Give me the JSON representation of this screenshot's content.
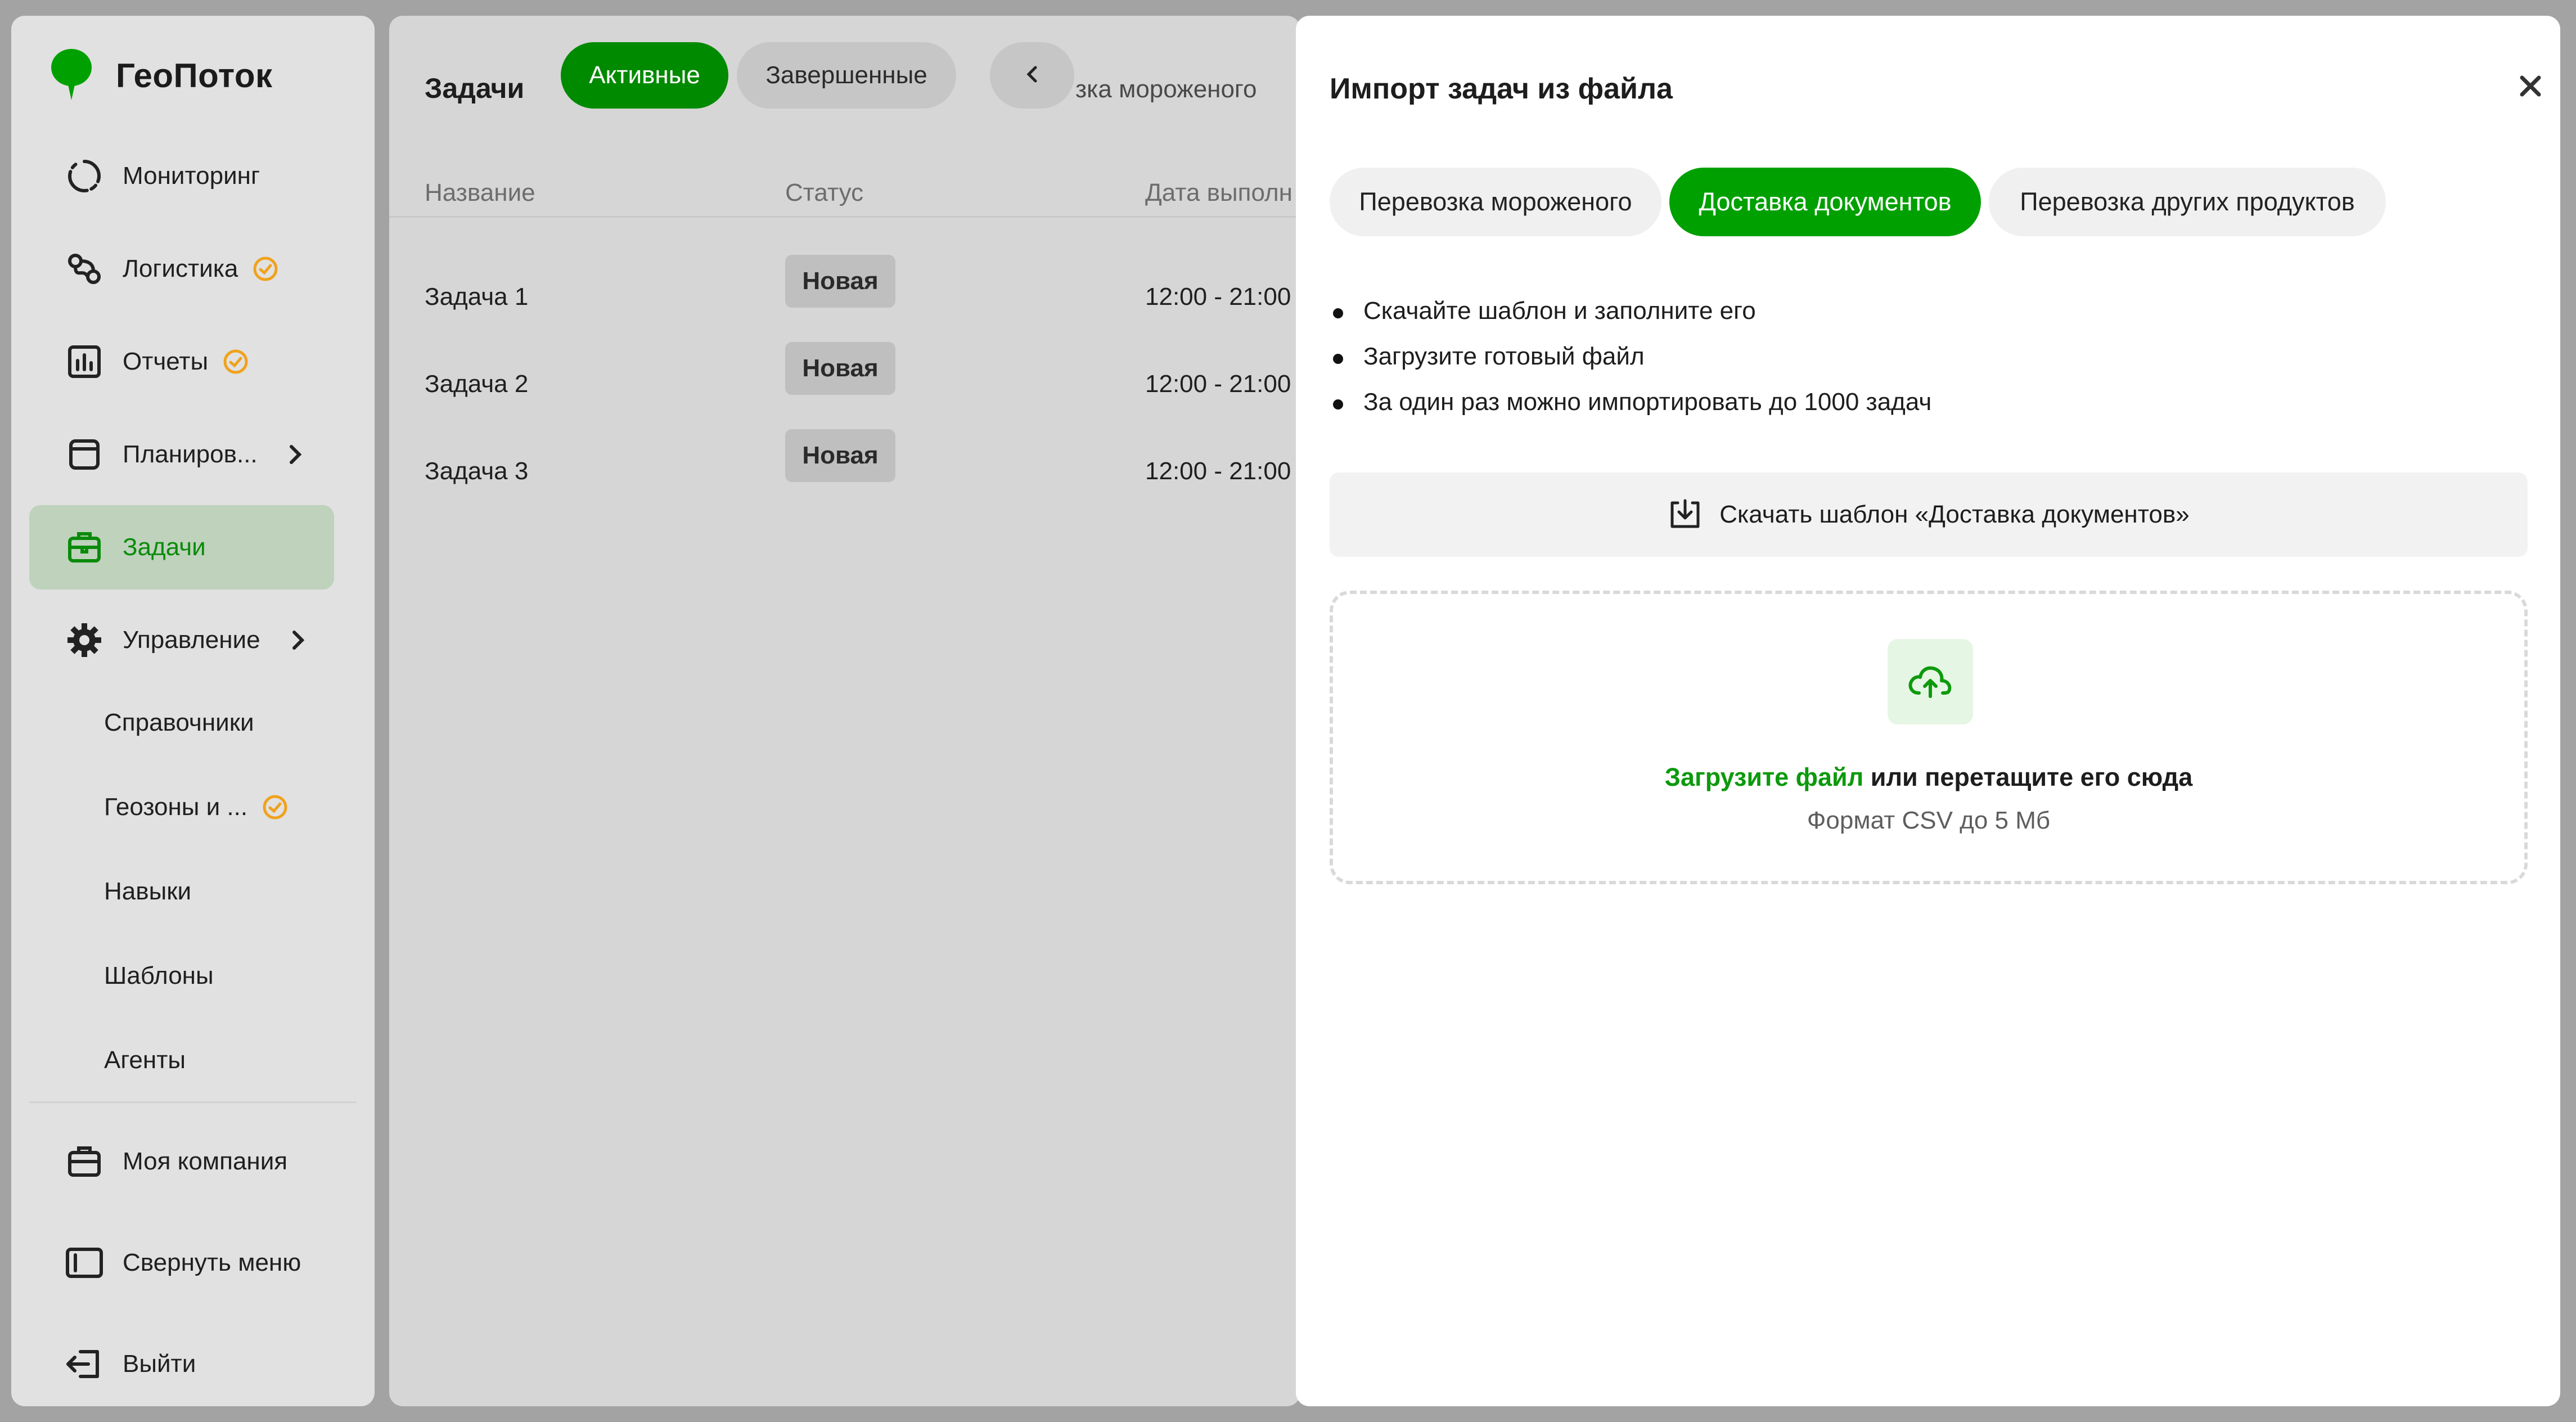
{
  "app": {
    "name": "ГеоПоток",
    "brand_color": "#00a000"
  },
  "sidebar": {
    "items": [
      {
        "label": "Мониторинг",
        "icon": "monitoring-icon"
      },
      {
        "label": "Логистика",
        "icon": "logistics-icon",
        "badge": "clock-badge-icon"
      },
      {
        "label": "Отчеты",
        "icon": "reports-icon",
        "badge": "clock-badge-icon"
      },
      {
        "label": "Планиров...",
        "icon": "planning-icon",
        "expandable": true
      },
      {
        "label": "Задачи",
        "icon": "tasks-icon",
        "active": true
      },
      {
        "label": "Управление",
        "icon": "gear-icon",
        "expandable": true
      }
    ],
    "sub_items": [
      {
        "label": "Справочники"
      },
      {
        "label": "Геозоны и ...",
        "badge": "clock-badge-icon"
      },
      {
        "label": "Навыки"
      },
      {
        "label": "Шаблоны"
      },
      {
        "label": "Агенты"
      }
    ],
    "bottom": [
      {
        "label": "Моя компания",
        "icon": "company-icon"
      },
      {
        "label": "Свернуть меню",
        "icon": "collapse-menu-icon"
      },
      {
        "label": "Выйти",
        "icon": "logout-icon"
      }
    ]
  },
  "main": {
    "title": "Задачи",
    "tabs": [
      {
        "label": "Активные",
        "selected": true
      },
      {
        "label": "Завершенные",
        "selected": false
      }
    ],
    "category_scroll_text": "зка мороженого",
    "columns": [
      "Название",
      "Статус",
      "Дата выполн"
    ],
    "rows": [
      {
        "name": "Задача 1",
        "status": "Новая",
        "date": "12:00 - 21:00"
      },
      {
        "name": "Задача 2",
        "status": "Новая",
        "date": "12:00 - 21:00"
      },
      {
        "name": "Задача 3",
        "status": "Новая",
        "date": "12:00 - 21:00"
      }
    ]
  },
  "modal": {
    "title": "Импорт задач из файла",
    "templates": [
      {
        "label": "Перевозка мороженого",
        "selected": false
      },
      {
        "label": "Доставка документов",
        "selected": true
      },
      {
        "label": "Перевозка других продуктов",
        "selected": false
      }
    ],
    "instructions": [
      "Скачайте шаблон и заполните его",
      "Загрузите готовый файл",
      "За один раз можно импортировать до 1000 задач"
    ],
    "download_label": "Скачать шаблон «Доставка документов»",
    "dropzone": {
      "link_text": "Загрузите файл",
      "rest_text": " или перетащите его сюда",
      "hint": "Формат CSV до 5 Мб"
    }
  }
}
